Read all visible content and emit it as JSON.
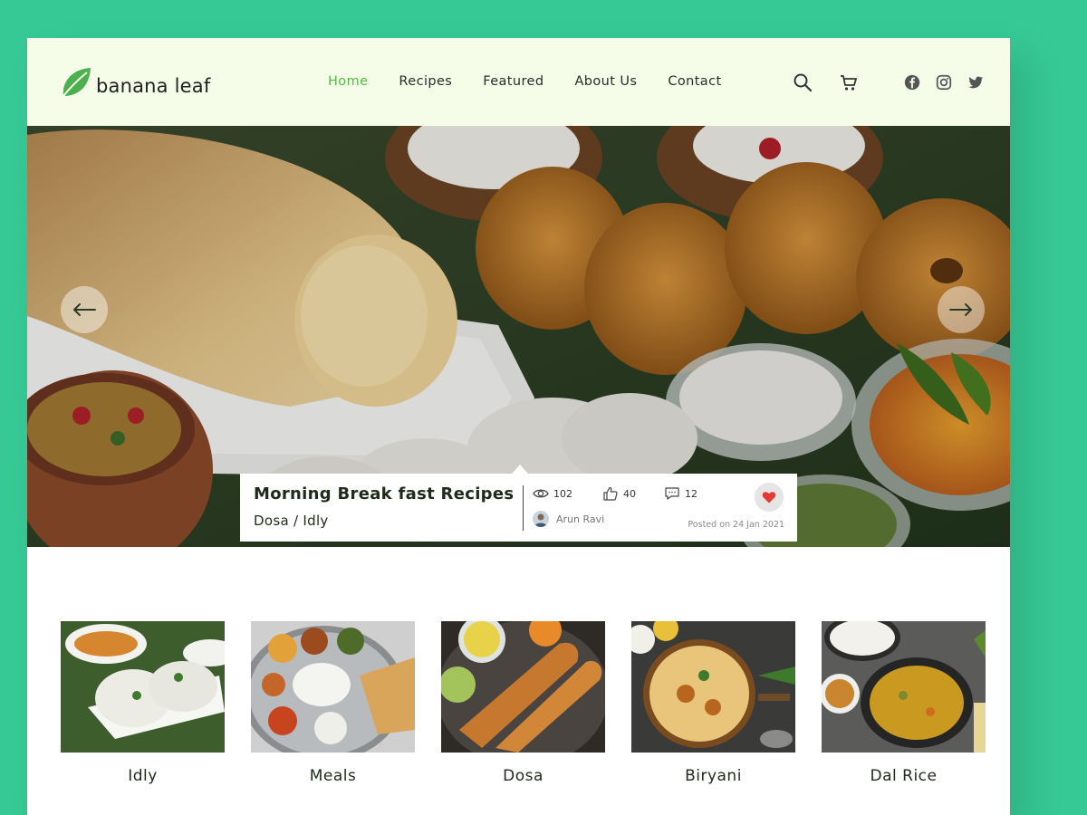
{
  "brand": {
    "name": "banana leaf",
    "color": "#54b948"
  },
  "nav": {
    "items": [
      {
        "label": "Home",
        "active": true
      },
      {
        "label": "Recipes",
        "active": false
      },
      {
        "label": "Featured",
        "active": false
      },
      {
        "label": "About Us",
        "active": false
      },
      {
        "label": "Contact",
        "active": false
      }
    ]
  },
  "header_icons": [
    "search-icon",
    "cart-icon",
    "facebook-icon",
    "instagram-icon",
    "twitter-icon"
  ],
  "hero": {
    "title": "Morning Break fast Recipes",
    "subtitle": "Dosa / Idly",
    "views": "102",
    "likes": "40",
    "comments": "12",
    "author": "Arun Ravi",
    "posted": "Posted on 24 Jan 2021"
  },
  "categories": [
    {
      "label": "Idly"
    },
    {
      "label": "Meals"
    },
    {
      "label": "Dosa"
    },
    {
      "label": "Biryani"
    },
    {
      "label": "Dal Rice"
    }
  ],
  "colors": {
    "background": "#36c996",
    "header_bg": "#f5fde9",
    "heart": "#e53935"
  }
}
